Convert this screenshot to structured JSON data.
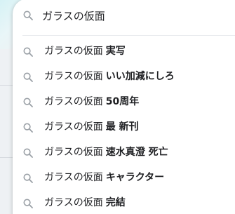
{
  "search": {
    "value": "ガラスの仮面",
    "icon": "search-icon"
  },
  "suggestions": [
    {
      "prefix": "ガラスの仮面",
      "completion": "実写"
    },
    {
      "prefix": "ガラスの仮面",
      "completion": "いい加減にしろ"
    },
    {
      "prefix": "ガラスの仮面",
      "completion": "50周年"
    },
    {
      "prefix": "ガラスの仮面",
      "completion": "最 新刊"
    },
    {
      "prefix": "ガラスの仮面",
      "completion": "速水真澄 死亡"
    },
    {
      "prefix": "ガラスの仮面",
      "completion": "キャラクター"
    },
    {
      "prefix": "ガラスの仮面",
      "completion": "完結"
    }
  ],
  "colors": {
    "icon": "#9aa0a6",
    "text": "#202124",
    "divider": "#e8eaed"
  }
}
